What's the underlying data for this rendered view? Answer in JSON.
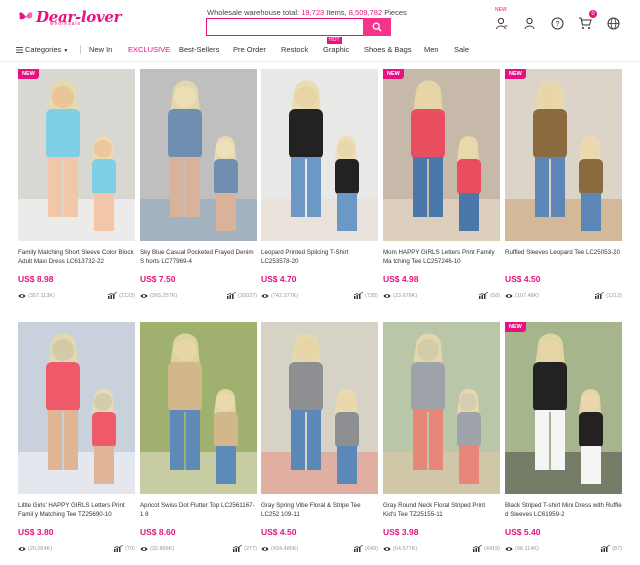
{
  "header": {
    "logo_text": "Dear-lover",
    "logo_sub": "wholesale",
    "stats_prefix": "Wholesale warehouse total: ",
    "items_count": "19,723",
    "items_suffix": " Items, ",
    "pieces_count": "8,509,782",
    "pieces_suffix": " Pieces",
    "search_placeholder": "",
    "new_label": "NEW",
    "cart_count": "0"
  },
  "nav": {
    "categories": "Categories",
    "items": [
      "New In",
      "EXCLUSIVE",
      "Best-Sellers",
      "Pre Order",
      "Restock",
      "Graphic",
      "Shoes & Bags",
      "Men",
      "Sale"
    ],
    "hot_label": "HOT"
  },
  "new_label": "NEW",
  "products": [
    {
      "title": "Family Matching Short Sleeve Color Block Adult Maxi Dress LC613732-22",
      "price": "US$ 8.98",
      "views": "(357.113K)",
      "sales": "(2123)",
      "new": true
    },
    {
      "title": "Sky Blue Casual Pocketed Frayed Denim S horts LC77969-4",
      "price": "US$ 7.50",
      "views": "(265.257K)",
      "sales": "(20037)",
      "new": false
    },
    {
      "title": "Leopard Printed Splicing T-Shirt LC253578-20",
      "price": "US$ 4.70",
      "views": "(742.377K)",
      "sales": "(735)",
      "new": false
    },
    {
      "title": "Mom HAPPY GIRLS Letters Print Family Ma tching Tee LC257246-10",
      "price": "US$ 4.98",
      "views": "(23.676K)",
      "sales": "(58)",
      "new": true
    },
    {
      "title": "Ruffled Sleeves Leopard Tee LC25053-20",
      "price": "US$ 4.50",
      "views": "(107.48K)",
      "sales": "(1212)",
      "new": true
    },
    {
      "title": "Little Girls' HAPPY GIRLS Letters Print Famil y Matching Tee TZ25690-10",
      "price": "US$ 3.80",
      "views": "(20.054K)",
      "sales": "(70)",
      "new": false
    },
    {
      "title": "Apricot Swiss Dot Flutter Top LC2561167-1 8",
      "price": "US$ 8.60",
      "views": "(32.866K)",
      "sales": "(277)",
      "new": false
    },
    {
      "title": "Gray Spring Vibe Floral & Stripe Tee LC252 109-11",
      "price": "US$ 4.50",
      "views": "(434.485K)",
      "sales": "(649)",
      "new": false
    },
    {
      "title": "Gray Round Neck Floral Striped Print Kid's Tee TZ25155-11",
      "price": "US$ 3.98",
      "views": "(64.577K)",
      "sales": "(4419)",
      "new": false
    },
    {
      "title": "Black Striped T-shirt Mini Dress with Ruffle d Sleeves LC61959-2",
      "price": "US$ 5.40",
      "views": "(98.114K)",
      "sales": "(87)",
      "new": true
    }
  ],
  "colors": {
    "accent": "#e6127f",
    "button": "#f6338c"
  }
}
